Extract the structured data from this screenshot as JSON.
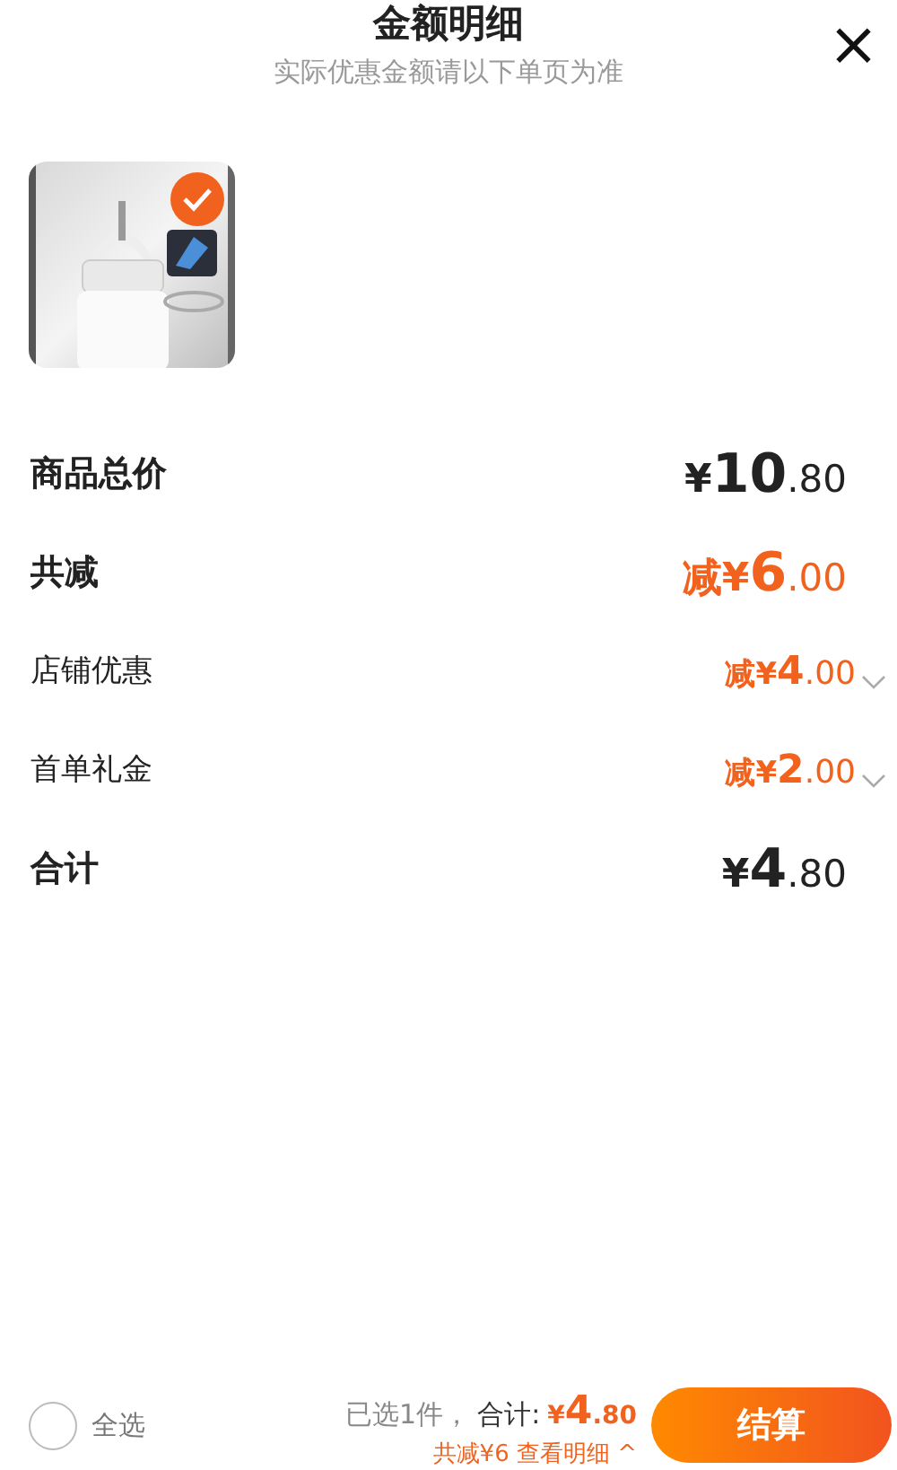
{
  "header": {
    "title": "金额明细",
    "subtitle": "实际优惠金额请以下单页为准",
    "close": "×"
  },
  "product": {
    "kind": "picture",
    "selected": true
  },
  "rows": [
    {
      "kind": "summary",
      "label": "商品总价",
      "discount": false,
      "symbol": "¥",
      "whole": "10",
      "fraction": ".80"
    },
    {
      "kind": "summary",
      "label": "共减",
      "discount": true,
      "prefix": "减",
      "symbol": "¥",
      "whole": "6",
      "fraction": ".00"
    },
    {
      "kind": "detail",
      "label": "店铺优惠",
      "discount": true,
      "prefix": "减",
      "symbol": "¥",
      "whole": "4",
      "fraction": ".00",
      "expandable": true
    },
    {
      "kind": "detail",
      "label": "首单礼金",
      "discount": true,
      "prefix": "减",
      "symbol": "¥",
      "whole": "2",
      "fraction": ".00",
      "expandable": true
    },
    {
      "kind": "summary",
      "label": "合计",
      "discount": false,
      "symbol": "¥",
      "whole": "4",
      "fraction": ".80"
    }
  ],
  "footer": {
    "select_all": {
      "label": "全选",
      "checked": false
    },
    "count": "已选1件，",
    "total_label": "合计:",
    "symbol": "¥",
    "whole": "4",
    "fraction": ".80",
    "savings": "共减¥6 查看明细",
    "savings_caret": "^",
    "checkout": "结算"
  }
}
